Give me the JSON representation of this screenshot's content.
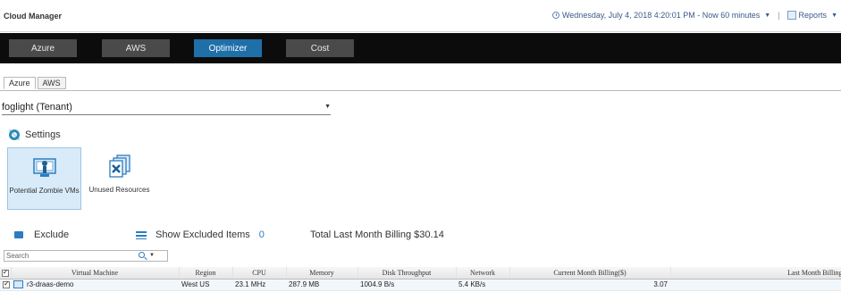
{
  "app": {
    "title": "Cloud Manager",
    "datetime": "Wednesday, July 4, 2018 4:20:01 PM - Now 60 minutes",
    "reports_label": "Reports",
    "separator": "|"
  },
  "nav": {
    "items": [
      {
        "label": "Azure"
      },
      {
        "label": "AWS"
      },
      {
        "label": "Optimizer",
        "active": true
      },
      {
        "label": "Cost"
      }
    ]
  },
  "subtabs": [
    {
      "label": "Azure",
      "active": true
    },
    {
      "label": "AWS"
    }
  ],
  "tenant": {
    "value": "foglight (Tenant)"
  },
  "settings_label": "Settings",
  "cards": [
    {
      "label": "Potential Zombie VMs",
      "icon": "zombie-vm-icon",
      "selected": true
    },
    {
      "label": "Unused Resources",
      "icon": "unused-resources-icon"
    }
  ],
  "actions": {
    "exclude_label": "Exclude",
    "show_excluded_label": "Show Excluded Items",
    "excluded_count": "0",
    "billing_text": "Total Last Month Billing $30.14"
  },
  "search": {
    "placeholder": "Search"
  },
  "table": {
    "columns": [
      "",
      "Virtual Machine",
      "Region",
      "CPU",
      "Memory",
      "Disk Throughput",
      "Network",
      "Current Month Billing($)",
      "Last Month Billing"
    ],
    "rows": [
      {
        "checked": true,
        "vm": "r3-draas-demo",
        "region": "West US",
        "cpu": "23.1 MHz",
        "memory": "287.9 MB",
        "disk": "1004.9 B/s",
        "network": "5.4 KB/s",
        "current_billing": "3.07",
        "last_billing": ""
      }
    ]
  },
  "colors": {
    "nav_bg": "#0c0c0c",
    "nav_button": "#4a4a4a",
    "nav_active": "#1f6fa9",
    "accent": "#2b7dc1"
  }
}
